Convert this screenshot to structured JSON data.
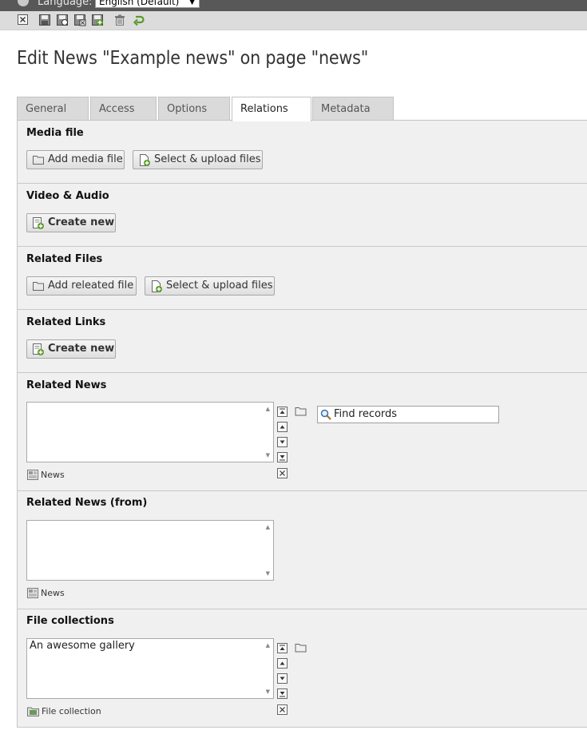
{
  "topbar": {
    "language_label": "Language:",
    "language_value": "English (Default)"
  },
  "toolbar": {
    "icons": [
      "close-icon",
      "save-icon",
      "save-and-view-icon",
      "save-and-close-icon",
      "save-and-new-icon",
      "delete-icon",
      "undo-icon"
    ]
  },
  "page_title": "Edit News \"Example news\" on page \"news\"",
  "tabs": [
    {
      "label": "General",
      "active": false
    },
    {
      "label": "Access",
      "active": false
    },
    {
      "label": "Options",
      "active": false
    },
    {
      "label": "Relations",
      "active": true
    },
    {
      "label": "Metadata",
      "active": false
    }
  ],
  "sections": {
    "media_file": {
      "title": "Media file",
      "add_label": "Add media file",
      "upload_label": "Select & upload files"
    },
    "video_audio": {
      "title": "Video & Audio",
      "create_label": "Create new"
    },
    "related_files": {
      "title": "Related Files",
      "add_label": "Add releated file",
      "upload_label": "Select & upload files"
    },
    "related_links": {
      "title": "Related Links",
      "create_label": "Create new"
    },
    "related_news": {
      "title": "Related News",
      "items": [],
      "table_label": "News",
      "find_placeholder": "Find records"
    },
    "related_news_from": {
      "title": "Related News (from)",
      "items": [],
      "table_label": "News"
    },
    "file_collections": {
      "title": "File collections",
      "items": [
        "An awesome gallery"
      ],
      "table_label": "File collection"
    }
  },
  "colors": {
    "topbar": "#585858",
    "toolbar": "#dcdcdc",
    "panel": "#f0f0f0",
    "icon_green": "#5a9a2a"
  }
}
